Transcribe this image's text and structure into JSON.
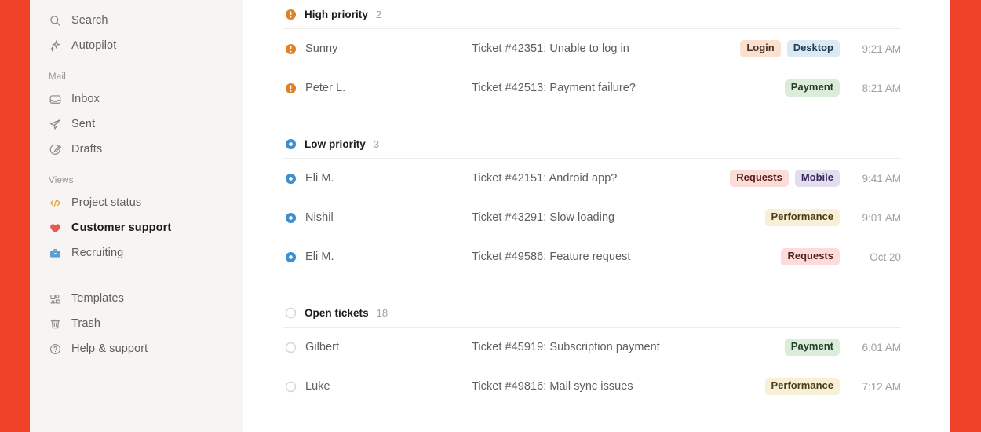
{
  "theme": {
    "rail_color": "#f04228",
    "sidebar_bg": "#f6f5f3",
    "content_bg": "#ffffff",
    "high_priority_color": "#e08128",
    "low_priority_color": "#3c8fd0",
    "open_ticket_color": "#d6d5d1"
  },
  "sidebar": {
    "top_items": [
      {
        "label": "Search",
        "icon": "search-icon",
        "name": "sidebar-item-search"
      },
      {
        "label": "Autopilot",
        "icon": "sparkle-icon",
        "name": "sidebar-item-autopilot"
      }
    ],
    "mail_group_title": "Mail",
    "mail_items": [
      {
        "label": "Inbox",
        "icon": "inbox-icon",
        "name": "sidebar-item-inbox"
      },
      {
        "label": "Sent",
        "icon": "paper-plane-icon",
        "name": "sidebar-item-sent"
      },
      {
        "label": "Drafts",
        "icon": "draft-pencil-circle-icon",
        "name": "sidebar-item-drafts"
      }
    ],
    "views_group_title": "Views",
    "views_items": [
      {
        "label": "Project status",
        "icon": "code-brackets-icon",
        "name": "sidebar-item-project-status",
        "icon_color": "#e2a33c",
        "active": false
      },
      {
        "label": "Customer support",
        "icon": "heart-icon",
        "name": "sidebar-item-customer-support",
        "icon_color": "#e8594f",
        "active": true
      },
      {
        "label": "Recruiting",
        "icon": "briefcase-icon",
        "name": "sidebar-item-recruiting",
        "icon_color": "#5a9fd4",
        "active": false
      }
    ],
    "utility_items": [
      {
        "label": "Templates",
        "icon": "templates-icon",
        "name": "sidebar-item-templates"
      },
      {
        "label": "Trash",
        "icon": "trash-icon",
        "name": "sidebar-item-trash"
      },
      {
        "label": "Help & support",
        "icon": "question-circle-icon",
        "name": "sidebar-item-help-support"
      }
    ]
  },
  "tag_styles": {
    "Login": {
      "bg": "#fae0ce",
      "fg": "#4a3326"
    },
    "Desktop": {
      "bg": "#dbe9f3",
      "fg": "#1f3a52"
    },
    "Payment": {
      "bg": "#dcecdb",
      "fg": "#24402a"
    },
    "Requests": {
      "bg": "#fbdcd9",
      "fg": "#5a2020"
    },
    "Mobile": {
      "bg": "#e2def0",
      "fg": "#36265c"
    },
    "Performance": {
      "bg": "#f8f0d6",
      "fg": "#4a3d1c"
    }
  },
  "sections": [
    {
      "name": "high-priority",
      "title": "High priority",
      "count": "2",
      "marker": "high-priority-icon",
      "rows": [
        {
          "sender": "Sunny",
          "subject": "Ticket #42351: Unable to log in",
          "tags": [
            "Login",
            "Desktop"
          ],
          "time": "9:21 AM"
        },
        {
          "sender": "Peter L.",
          "subject": "Ticket #42513: Payment failure?",
          "tags": [
            "Payment"
          ],
          "time": "8:21 AM"
        }
      ]
    },
    {
      "name": "low-priority",
      "title": "Low priority",
      "count": "3",
      "marker": "low-priority-icon",
      "rows": [
        {
          "sender": "Eli M.",
          "subject": "Ticket #42151: Android app?",
          "tags": [
            "Requests",
            "Mobile"
          ],
          "time": "9:41 AM"
        },
        {
          "sender": "Nishil",
          "subject": "Ticket #43291: Slow loading",
          "tags": [
            "Performance"
          ],
          "time": "9:01 AM"
        },
        {
          "sender": "Eli M.",
          "subject": "Ticket #49586: Feature request",
          "tags": [
            "Requests"
          ],
          "time": "Oct 20"
        }
      ]
    },
    {
      "name": "open-tickets",
      "title": "Open tickets",
      "count": "18",
      "marker": "open-ticket-icon",
      "rows": [
        {
          "sender": "Gilbert",
          "subject": "Ticket #45919: Subscription payment",
          "tags": [
            "Payment"
          ],
          "time": "6:01 AM"
        },
        {
          "sender": "Luke",
          "subject": "Ticket #49816: Mail sync issues",
          "tags": [
            "Performance"
          ],
          "time": "7:12 AM"
        }
      ]
    }
  ]
}
